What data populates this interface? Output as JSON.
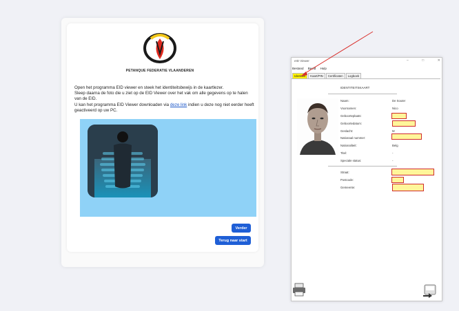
{
  "left_card": {
    "org_name": "PETANQUE FEDERATIE VLAANDEREN",
    "instructions": {
      "line1": "Open het programma EID viewer en steek het identiteitsbewijs in de kaartlezer.",
      "line2": "Sleep daarna de foto die u ziet op de EID Viewer over het vak om alle gegevens op te halen van de EID.",
      "line3_before": "U kan het programma EID Viewer downloaden via ",
      "link": "deze link",
      "line3_after": " indien u deze nog niet eerder heeft geactiveerd op uw PC."
    },
    "buttons": {
      "next": "Verder",
      "back": "Terug naar start"
    }
  },
  "eid_viewer": {
    "title": "eID Viewer",
    "window_controls": "– □ ✕",
    "menu": [
      "Bestand",
      "Beeld",
      "Hulp"
    ],
    "tabs": [
      "Identiteit",
      "Kaart/PIN",
      "Certificaten",
      "Logboek"
    ],
    "active_tab": "Identiteit",
    "card_title": "IDENTITEITSKAART",
    "fields": {
      "naam": {
        "label": "Naam:",
        "value": "De Souter"
      },
      "voornamen": {
        "label": "Voornamen:",
        "value": "Nico"
      },
      "geboorteplaats": {
        "label": "Geboorteplaats:",
        "value": ""
      },
      "geboortedatum": {
        "label": "Geboortedatum:",
        "value": ""
      },
      "geslacht": {
        "label": "Geslacht:",
        "value": "M"
      },
      "nationaal_nummer": {
        "label": "Nationaal nummer:",
        "value": ""
      },
      "nationaliteit": {
        "label": "Nationaliteit:",
        "value": "Belg"
      },
      "titel": {
        "label": "Titel:",
        "value": "-"
      },
      "speciale_status": {
        "label": "Speciale status:",
        "value": "-"
      },
      "straat": {
        "label": "Straat:",
        "value": ""
      },
      "postcode": {
        "label": "Postcode:",
        "value": ""
      },
      "gemeente": {
        "label": "Gemeente:",
        "value": ""
      }
    },
    "icons": [
      "printer-icon",
      "exit-icon"
    ]
  },
  "colors": {
    "page_bg": "#f0f1f6",
    "blue_panel": "#8fd2f7",
    "button_blue": "#1f5fd6",
    "highlight_yellow": "#fff200",
    "redaction_border": "#cf2b2b",
    "arrow_red": "#d9302c"
  }
}
